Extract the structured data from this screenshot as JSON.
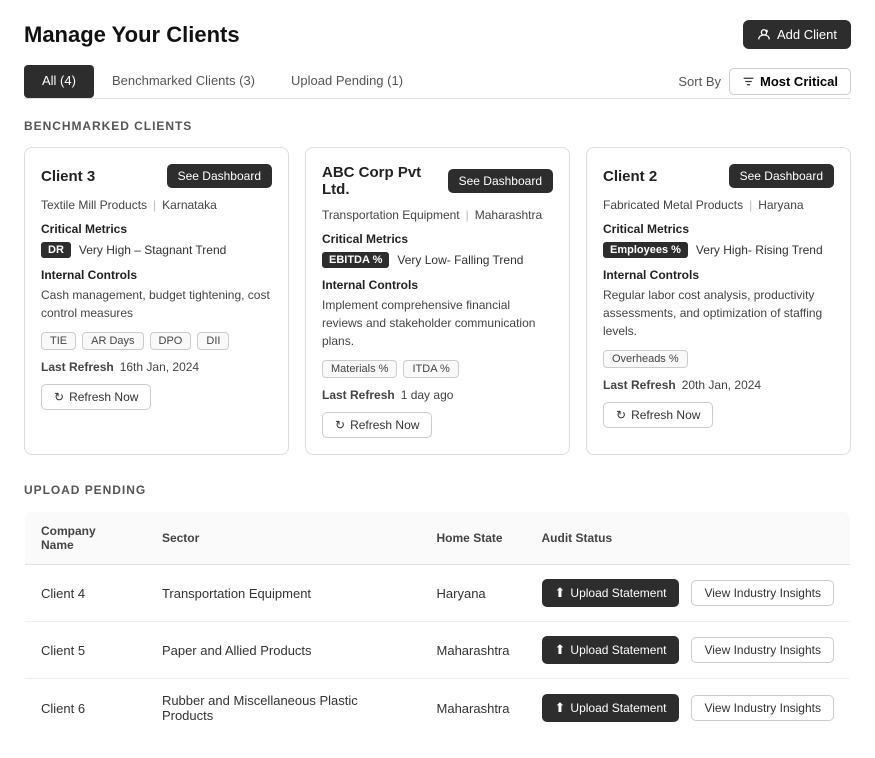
{
  "header": {
    "title": "Manage Your Clients",
    "add_client_label": "Add Client"
  },
  "tabs": [
    {
      "id": "all",
      "label": "All (4)",
      "active": true
    },
    {
      "id": "benchmarked",
      "label": "Benchmarked Clients (3)",
      "active": false
    },
    {
      "id": "upload_pending",
      "label": "Upload Pending (1)",
      "active": false
    }
  ],
  "sort_bar": {
    "label": "Sort By",
    "value": "Most Critical"
  },
  "benchmarked_section": {
    "title": "BENCHMARKED CLIENTS",
    "clients": [
      {
        "name": "Client 3",
        "see_dashboard_label": "See Dashboard",
        "industry": "Textile Mill Products",
        "state": "Karnataka",
        "critical_metrics_label": "Critical Metrics",
        "metric_badge": "DR",
        "metric_trend": "Very High – Stagnant Trend",
        "internal_controls_label": "Internal Controls",
        "internal_controls_text": "Cash management, budget tightening, cost control measures",
        "tags": [
          "TIE",
          "AR Days",
          "DPO",
          "DII"
        ],
        "last_refresh_label": "Last Refresh",
        "last_refresh_value": "16th Jan, 2024",
        "refresh_btn_label": "Refresh Now"
      },
      {
        "name": "ABC Corp Pvt Ltd.",
        "see_dashboard_label": "See Dashboard",
        "industry": "Transportation Equipment",
        "state": "Maharashtra",
        "critical_metrics_label": "Critical Metrics",
        "metric_badge": "EBITDA %",
        "metric_trend": "Very Low- Falling Trend",
        "internal_controls_label": "Internal Controls",
        "internal_controls_text": "Implement comprehensive financial reviews and stakeholder communication plans.",
        "tags": [
          "Materials %",
          "ITDA %"
        ],
        "last_refresh_label": "Last Refresh",
        "last_refresh_value": "1 day ago",
        "refresh_btn_label": "Refresh Now"
      },
      {
        "name": "Client 2",
        "see_dashboard_label": "See Dashboard",
        "industry": "Fabricated Metal Products",
        "state": "Haryana",
        "critical_metrics_label": "Critical Metrics",
        "metric_badge": "Employees %",
        "metric_trend": "Very High- Rising Trend",
        "internal_controls_label": "Internal Controls",
        "internal_controls_text": "Regular labor cost analysis, productivity assessments, and optimization of staffing levels.",
        "tags": [
          "Overheads %"
        ],
        "last_refresh_label": "Last Refresh",
        "last_refresh_value": "20th Jan, 2024",
        "refresh_btn_label": "Refresh Now"
      }
    ]
  },
  "upload_pending_section": {
    "title": "UPLOAD PENDING",
    "table_headers": [
      "Company Name",
      "Sector",
      "Home State",
      "Audit Status"
    ],
    "rows": [
      {
        "company": "Client 4",
        "sector": "Transportation Equipment",
        "state": "Haryana",
        "upload_label": "Upload Statement",
        "insights_label": "View Industry Insights"
      },
      {
        "company": "Client 5",
        "sector": "Paper and Allied Products",
        "state": "Maharashtra",
        "upload_label": "Upload Statement",
        "insights_label": "View Industry Insights"
      },
      {
        "company": "Client 6",
        "sector": "Rubber and Miscellaneous Plastic Products",
        "state": "Maharashtra",
        "upload_label": "Upload Statement",
        "insights_label": "View Industry Insights"
      }
    ]
  }
}
